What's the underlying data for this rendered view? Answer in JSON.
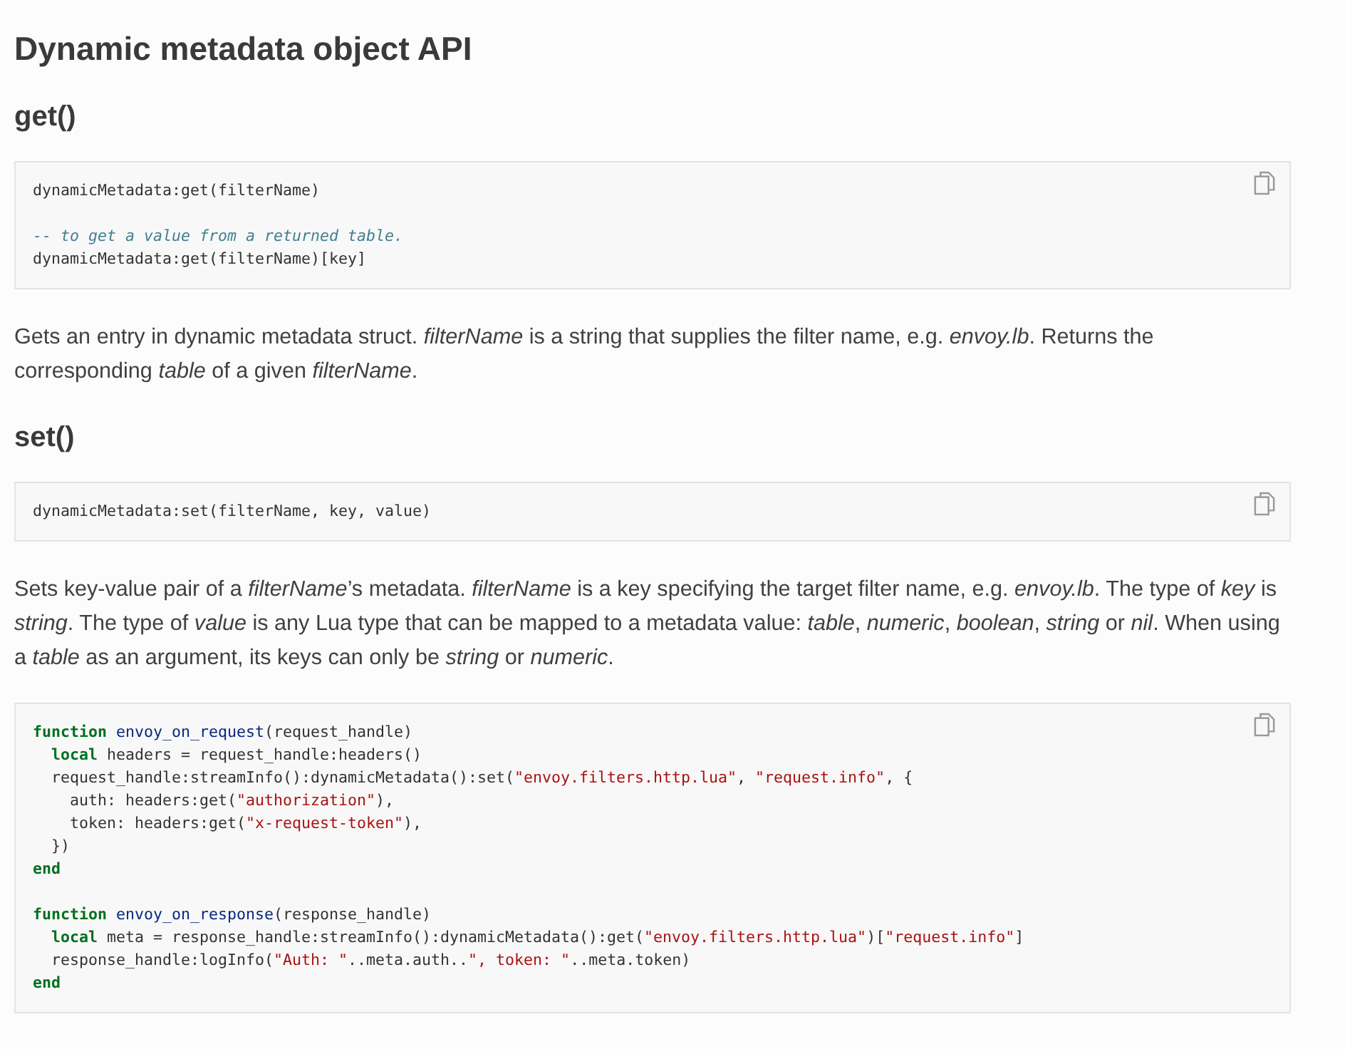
{
  "title": "Dynamic metadata object API",
  "sections": [
    {
      "heading": "get()",
      "code": [
        [
          [
            {
              "kind": "plain",
              "text": "dynamicMetadata:get(filterName)"
            }
          ]
        ],
        [
          [
            {
              "kind": "comment",
              "text": "-- to get a value from a returned table."
            }
          ],
          [
            {
              "kind": "plain",
              "text": "dynamicMetadata:get(filterName)[key]"
            }
          ]
        ]
      ],
      "text": "Gets an entry in dynamic metadata struct. *filterName* is a string that supplies the filter name, e.g. *envoy.lb*. Returns the corresponding *table* of a given *filterName*."
    },
    {
      "heading": "set()",
      "code": [
        [
          [
            {
              "kind": "plain",
              "text": "dynamicMetadata:set(filterName, key, value)"
            }
          ]
        ]
      ],
      "text": "Sets key-value pair of a *filterName*’s metadata. *filterName* is a key specifying the target filter name, e.g. *envoy.lb*. The type of *key* is *string*. The type of *value* is any Lua type that can be mapped to a metadata value: *table*, *numeric*, *boolean*, *string* or *nil*. When using a *table* as an argument, its keys can only be *string* or *numeric*."
    }
  ],
  "example": [
    [
      [
        {
          "kind": "keyword",
          "text": "function"
        },
        {
          "kind": "func",
          "text": " envoy_on_request"
        },
        {
          "kind": "plain",
          "text": "(request_handle)"
        }
      ],
      [
        {
          "kind": "keyword",
          "text": "  local"
        },
        {
          "kind": "plain",
          "text": " headers = request_handle:headers()"
        }
      ],
      [
        {
          "kind": "plain",
          "text": "  request_handle:streamInfo():dynamicMetadata():set("
        },
        {
          "kind": "string",
          "text": "\"envoy.filters.http.lua\""
        },
        {
          "kind": "plain",
          "text": ", "
        },
        {
          "kind": "string",
          "text": "\"request.info\""
        },
        {
          "kind": "plain",
          "text": ", {"
        }
      ],
      [
        {
          "kind": "plain",
          "text": "    auth: headers:get("
        },
        {
          "kind": "string",
          "text": "\"authorization\""
        },
        {
          "kind": "plain",
          "text": "),"
        }
      ],
      [
        {
          "kind": "plain",
          "text": "    token: headers:get("
        },
        {
          "kind": "string",
          "text": "\"x-request-token\""
        },
        {
          "kind": "plain",
          "text": "),"
        }
      ],
      [
        {
          "kind": "plain",
          "text": "  })"
        }
      ],
      [
        {
          "kind": "keyword",
          "text": "end"
        }
      ]
    ],
    [
      [
        {
          "kind": "keyword",
          "text": "function"
        },
        {
          "kind": "func",
          "text": " envoy_on_response"
        },
        {
          "kind": "plain",
          "text": "(response_handle)"
        }
      ],
      [
        {
          "kind": "keyword",
          "text": "  local"
        },
        {
          "kind": "plain",
          "text": " meta = response_handle:streamInfo():dynamicMetadata():get("
        },
        {
          "kind": "string",
          "text": "\"envoy.filters.http.lua\""
        },
        {
          "kind": "plain",
          "text": ")["
        },
        {
          "kind": "string",
          "text": "\"request.info\""
        },
        {
          "kind": "plain",
          "text": "]"
        }
      ],
      [
        {
          "kind": "plain",
          "text": "  response_handle:logInfo("
        },
        {
          "kind": "string",
          "text": "\"Auth: \""
        },
        {
          "kind": "plain",
          "text": "..meta.auth.."
        },
        {
          "kind": "string",
          "text": "\", token: \""
        },
        {
          "kind": "plain",
          "text": "..meta.token)"
        }
      ],
      [
        {
          "kind": "keyword",
          "text": "end"
        }
      ]
    ]
  ]
}
